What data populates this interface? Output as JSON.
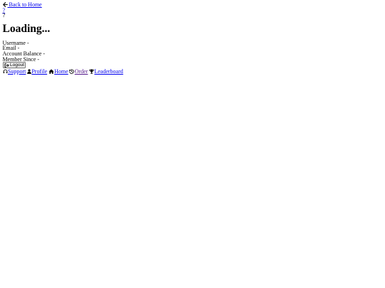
{
  "back_link": {
    "label": "Back to Home",
    "icon": "arrow-left-icon"
  },
  "avatar_placeholders": [
    "?",
    "?"
  ],
  "page_title": "Loading...",
  "profile_fields": [
    {
      "label": "Username",
      "value": "-"
    },
    {
      "label": "Email",
      "value": "-"
    },
    {
      "label": "Account Balance",
      "value": "-"
    },
    {
      "label": "Member Since",
      "value": "-"
    }
  ],
  "logout": {
    "label": "Logout",
    "icon": "logout-icon"
  },
  "nav": [
    {
      "label": "Support",
      "icon": "headset-icon"
    },
    {
      "label": "Profile",
      "icon": "user-icon"
    },
    {
      "label": "Home",
      "icon": "home-icon"
    },
    {
      "label": "Order",
      "icon": "history-icon"
    },
    {
      "label": "Leaderboard",
      "icon": "trophy-icon"
    }
  ],
  "colors": {
    "link": "#0000ee",
    "visited_link": "#551a8b",
    "text": "#000000",
    "background": "#ffffff"
  }
}
